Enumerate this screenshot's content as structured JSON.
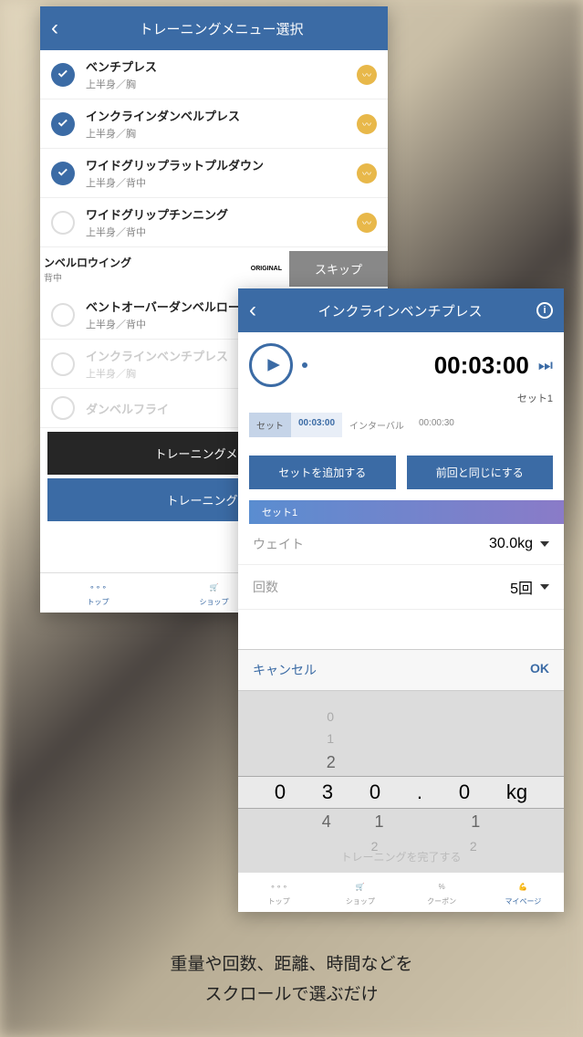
{
  "phone1": {
    "title": "トレーニングメニュー選択",
    "items": [
      {
        "name": "ベンチプレス",
        "cat": "上半身／胸",
        "checked": true,
        "badge": true
      },
      {
        "name": "インクラインダンベルプレス",
        "cat": "上半身／胸",
        "checked": true,
        "badge": true
      },
      {
        "name": "ワイドグリップラットプルダウン",
        "cat": "上半身／背中",
        "checked": true,
        "badge": true
      },
      {
        "name": "ワイドグリップチンニング",
        "cat": "上半身／背中",
        "checked": false,
        "badge": true
      }
    ],
    "skip_item": {
      "name": "ンベルロウイング",
      "cat": "背中",
      "original": "ORIGINAL",
      "skip": "スキップ"
    },
    "more": [
      {
        "name": "ベントオーバーダンベルロー",
        "cat": "上半身／背中",
        "dim": false
      },
      {
        "name": "インクラインベンチプレス",
        "cat": "上半身／胸",
        "dim": true
      },
      {
        "name": "ダンベルフライ",
        "cat": "",
        "dim": true
      }
    ],
    "btn1": "トレーニングメニュー",
    "btn2": "トレーニングを終",
    "tabs": [
      {
        "label": "トップ"
      },
      {
        "label": "ショップ"
      }
    ]
  },
  "phone2": {
    "title": "インクラインベンチプレス",
    "timer": "00:03:00",
    "set_label": "セット1",
    "seg": {
      "a": "セット",
      "b": "00:03:00",
      "c": "インターバル",
      "d": "00:00:30"
    },
    "add_set": "セットを追加する",
    "same_prev": "前回と同じにする",
    "set_tab": "セット1",
    "rows": [
      {
        "label": "ウェイト",
        "value": "30.0kg"
      },
      {
        "label": "回数",
        "value": "5回"
      }
    ],
    "cancel": "キャンセル",
    "ok": "OK",
    "picker": {
      "r0": [
        "",
        "0",
        "",
        "",
        "",
        ""
      ],
      "r1": [
        "",
        "1",
        "",
        "",
        "",
        ""
      ],
      "r2": [
        "",
        "2",
        "",
        "",
        "",
        ""
      ],
      "sel": [
        "0",
        "3",
        "0",
        ".",
        "0",
        "kg"
      ],
      "r4": [
        "",
        "4",
        "1",
        "",
        "1",
        ""
      ],
      "r5": [
        "",
        "",
        "2",
        "",
        "2",
        ""
      ],
      "hint": "トレーニングを完了する"
    },
    "tabs": [
      {
        "label": "トップ"
      },
      {
        "label": "ショップ"
      },
      {
        "label": "クーポン"
      },
      {
        "label": "マイページ"
      }
    ]
  },
  "caption": {
    "l1": "重量や回数、距離、時間などを",
    "l2": "スクロールで選ぶだけ"
  }
}
